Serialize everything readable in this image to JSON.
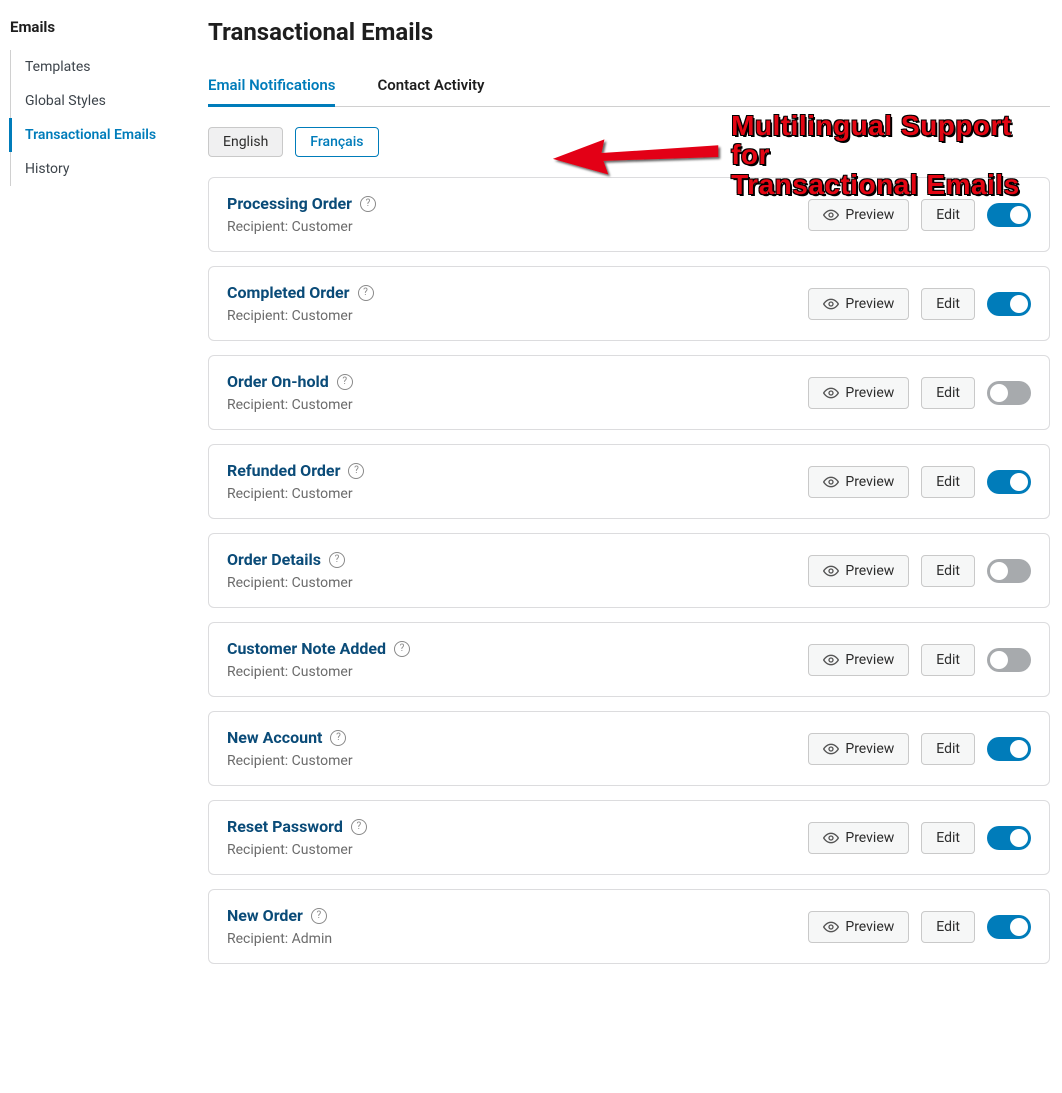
{
  "sidebar": {
    "title": "Emails",
    "items": [
      {
        "label": "Templates",
        "active": false
      },
      {
        "label": "Global Styles",
        "active": false
      },
      {
        "label": "Transactional Emails",
        "active": true
      },
      {
        "label": "History",
        "active": false
      }
    ]
  },
  "page": {
    "title": "Transactional Emails"
  },
  "tabs": [
    {
      "label": "Email Notifications",
      "active": true
    },
    {
      "label": "Contact Activity",
      "active": false
    }
  ],
  "languages": [
    {
      "label": "English",
      "variant": "selected"
    },
    {
      "label": "Français",
      "variant": "outlined"
    }
  ],
  "buttons": {
    "preview": "Preview",
    "edit": "Edit"
  },
  "recipient_label": "Recipient:",
  "annotation": {
    "line1": "Multilingual Support for",
    "line2": "Transactional Emails"
  },
  "emails": [
    {
      "title": "Processing Order",
      "recipient": "Customer",
      "enabled": true
    },
    {
      "title": "Completed Order",
      "recipient": "Customer",
      "enabled": true
    },
    {
      "title": "Order On-hold",
      "recipient": "Customer",
      "enabled": false
    },
    {
      "title": "Refunded Order",
      "recipient": "Customer",
      "enabled": true
    },
    {
      "title": "Order Details",
      "recipient": "Customer",
      "enabled": false
    },
    {
      "title": "Customer Note Added",
      "recipient": "Customer",
      "enabled": false
    },
    {
      "title": "New Account",
      "recipient": "Customer",
      "enabled": true
    },
    {
      "title": "Reset Password",
      "recipient": "Customer",
      "enabled": true
    },
    {
      "title": "New Order",
      "recipient": "Admin",
      "enabled": true
    }
  ]
}
